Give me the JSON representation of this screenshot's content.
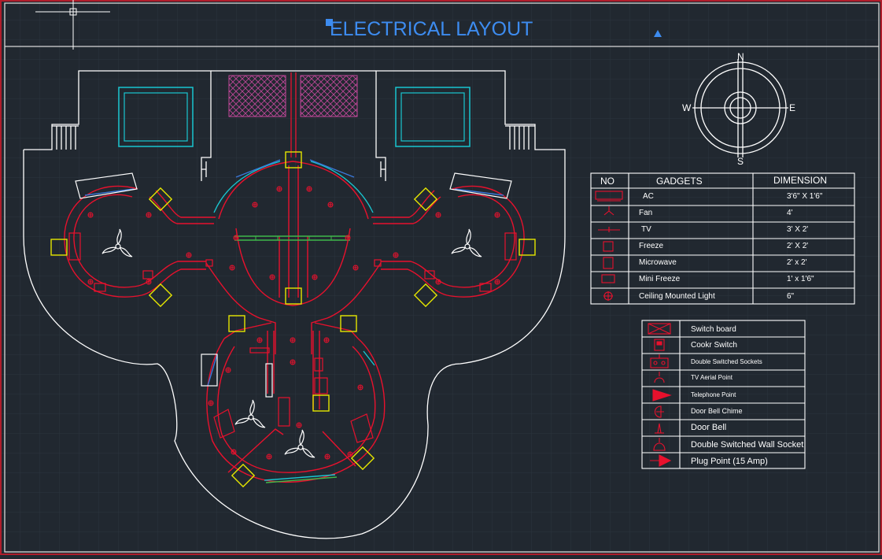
{
  "title": "ELECTRICAL LAYOUT",
  "compass": {
    "n": "N",
    "s": "S",
    "e": "E",
    "w": "W"
  },
  "gadgets_table": {
    "headers": [
      "NO",
      "GADGETS",
      "DIMENSION"
    ],
    "rows": [
      {
        "symbol": "ac-icon",
        "name": "AC",
        "dimension": "3'6\" X 1'6\""
      },
      {
        "symbol": "fan-icon",
        "name": "Fan",
        "dimension": "4'"
      },
      {
        "symbol": "tv-icon",
        "name": "TV",
        "dimension": "3' X 2'"
      },
      {
        "symbol": "freeze-icon",
        "name": "Freeze",
        "dimension": "2' X 2'"
      },
      {
        "symbol": "microwave-icon",
        "name": "Microwave",
        "dimension": "2' x 2'"
      },
      {
        "symbol": "mini-freeze-icon",
        "name": "Mini Freeze",
        "dimension": "1' x 1'6\""
      },
      {
        "symbol": "ceiling-light-icon",
        "name": "Ceiling Mounted Light",
        "dimension": "6\""
      }
    ]
  },
  "legend": {
    "rows": [
      {
        "symbol": "switch-board-icon",
        "label": "Switch board"
      },
      {
        "symbol": "cooker-switch-icon",
        "label": "Cookr Switch"
      },
      {
        "symbol": "double-socket-icon",
        "label": "Double Switched Sockets"
      },
      {
        "symbol": "tv-aerial-icon",
        "label": "TV Aerial Point"
      },
      {
        "symbol": "telephone-point-icon",
        "label": "Telephone Point"
      },
      {
        "symbol": "door-bell-chime-icon",
        "label": "Door Bell Chime"
      },
      {
        "symbol": "door-bell-icon",
        "label": "Door Bell"
      },
      {
        "symbol": "wall-socket-icon",
        "label": "Double Switched Wall Socket"
      },
      {
        "symbol": "plug-point-icon",
        "label": "Plug Point (15 Amp)"
      }
    ]
  },
  "colors": {
    "background": "#212830",
    "grid": "#2c353e",
    "wall": "#ffffff",
    "frame": "#b01d2b",
    "red": "#e8112d",
    "yellow": "#e6e600",
    "cyan": "#19c6d0",
    "title": "#3d8cf0",
    "magenta": "#c2479a",
    "green": "#3fb84a",
    "blue": "#3a78d8"
  }
}
